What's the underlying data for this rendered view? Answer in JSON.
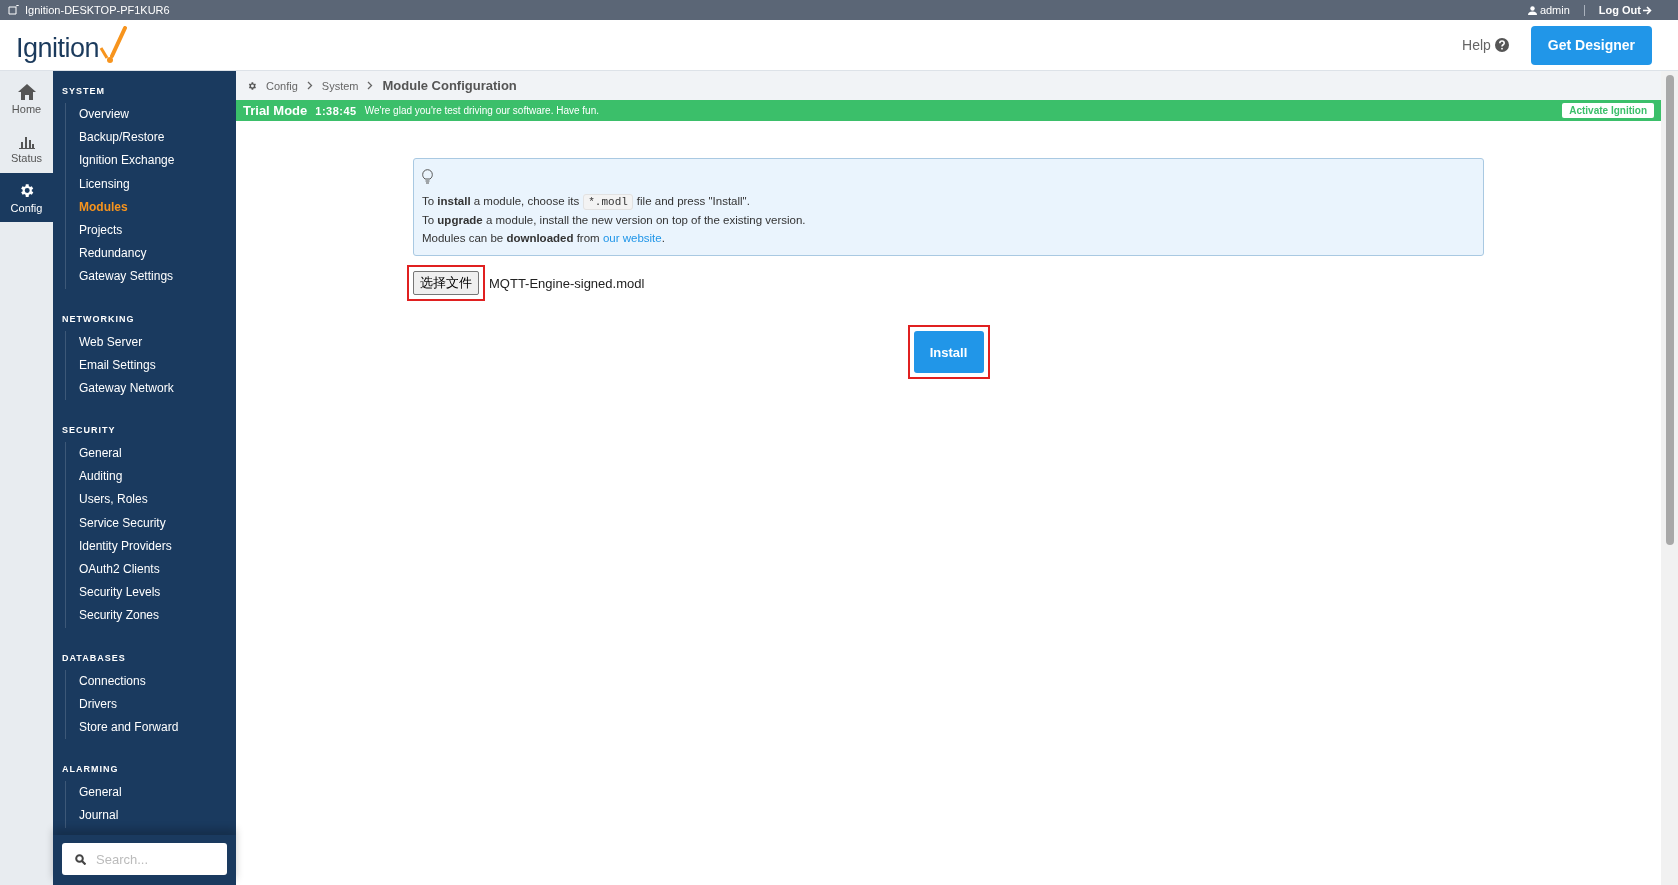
{
  "window": {
    "title": "Ignition-DESKTOP-PF1KUR6"
  },
  "user": {
    "name": "admin",
    "logout": "Log Out"
  },
  "header": {
    "logo": "Ignition",
    "help": "Help",
    "get_designer": "Get Designer"
  },
  "rail": [
    {
      "label": "Home",
      "kind": "home",
      "selected": false
    },
    {
      "label": "Status",
      "kind": "status",
      "selected": false
    },
    {
      "label": "Config",
      "kind": "config",
      "selected": true
    }
  ],
  "sidebar": {
    "sections": [
      {
        "title": "SYSTEM",
        "items": [
          {
            "label": "Overview",
            "selected": false
          },
          {
            "label": "Backup/Restore",
            "selected": false
          },
          {
            "label": "Ignition Exchange",
            "selected": false
          },
          {
            "label": "Licensing",
            "selected": false
          },
          {
            "label": "Modules",
            "selected": true
          },
          {
            "label": "Projects",
            "selected": false
          },
          {
            "label": "Redundancy",
            "selected": false
          },
          {
            "label": "Gateway Settings",
            "selected": false
          }
        ]
      },
      {
        "title": "NETWORKING",
        "items": [
          {
            "label": "Web Server",
            "selected": false
          },
          {
            "label": "Email Settings",
            "selected": false
          },
          {
            "label": "Gateway Network",
            "selected": false
          }
        ]
      },
      {
        "title": "SECURITY",
        "items": [
          {
            "label": "General",
            "selected": false
          },
          {
            "label": "Auditing",
            "selected": false
          },
          {
            "label": "Users, Roles",
            "selected": false
          },
          {
            "label": "Service Security",
            "selected": false
          },
          {
            "label": "Identity Providers",
            "selected": false
          },
          {
            "label": "OAuth2 Clients",
            "selected": false
          },
          {
            "label": "Security Levels",
            "selected": false
          },
          {
            "label": "Security Zones",
            "selected": false
          }
        ]
      },
      {
        "title": "DATABASES",
        "items": [
          {
            "label": "Connections",
            "selected": false
          },
          {
            "label": "Drivers",
            "selected": false
          },
          {
            "label": "Store and Forward",
            "selected": false
          }
        ]
      },
      {
        "title": "ALARMING",
        "items": [
          {
            "label": "General",
            "selected": false
          },
          {
            "label": "Journal",
            "selected": false
          }
        ]
      }
    ],
    "search": {
      "placeholder": "Search..."
    }
  },
  "breadcrumb": [
    "Config",
    "System",
    "Module Configuration"
  ],
  "trial": {
    "title": "Trial Mode",
    "time": "1:38:45",
    "message": "We're glad you're test driving our software. Have fun.",
    "button": "Activate Ignition"
  },
  "info": {
    "lines": [
      {
        "text": "To **install** a module, choose its",
        "code": "*.modl",
        "after": "file and press \"Install\"."
      },
      {
        "text": "To **upgrade** a module, install the new version on top of the existing version."
      },
      {
        "text": "Modules can be **downloaded** from",
        "link": "our website",
        "after": "."
      }
    ]
  },
  "file": {
    "button": "选择文件",
    "name": "MQTT-Engine-signed.modl",
    "highlighted": true
  },
  "install": {
    "label": "Install",
    "highlighted": true
  }
}
